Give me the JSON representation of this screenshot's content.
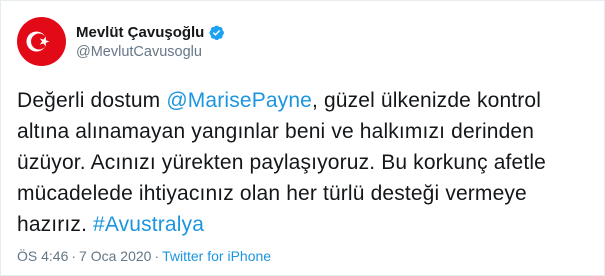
{
  "author": {
    "display_name": "Mevlüt Çavuşoğlu",
    "handle": "@MevlutCavusoglu",
    "verified": true,
    "avatar_icon": "turkish-flag-avatar",
    "verified_icon": "verified-badge-icon"
  },
  "tweet": {
    "line1_pre": "Değerli dostum ",
    "mention": "@MarisePayne",
    "line1_post": ", güzel ülkenizde kontrol",
    "line2": "altına alınamayan yangınlar beni ve halkımızı derinden",
    "line3": "üzüyor. Acınızı yürekten paylaşıyoruz. Bu korkunç afetle",
    "line4": "mücadelede ihtiyacınız olan her türlü desteği vermeye",
    "line5_pre": "hazırız. ",
    "hashtag": "#Avustralya"
  },
  "meta": {
    "time": "ÖS 4:46",
    "separator": "·",
    "date": "7 Oca 2020",
    "source": "Twitter for iPhone"
  },
  "colors": {
    "link": "#1b95e0",
    "verified": "#1da1f2",
    "flag_red": "#e30a17",
    "secondary_text": "#657786"
  }
}
